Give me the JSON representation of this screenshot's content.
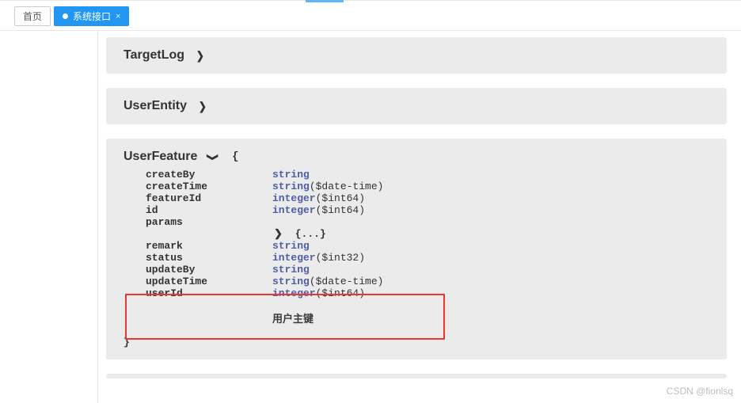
{
  "top_marker": "",
  "tabs": {
    "home": "首页",
    "active": "系统接口",
    "close_glyph": "×"
  },
  "models": {
    "targetlog": {
      "title": "TargetLog"
    },
    "userentity": {
      "title": "UserEntity"
    },
    "userfeature": {
      "title": "UserFeature",
      "open_brace": "{",
      "close_brace": "}",
      "props": [
        {
          "name": "createBy",
          "type": "string",
          "format": ""
        },
        {
          "name": "createTime",
          "type": "string",
          "format": "($date-time)"
        },
        {
          "name": "featureId",
          "type": "integer",
          "format": "($int64)"
        },
        {
          "name": "id",
          "type": "integer",
          "format": "($int64)"
        },
        {
          "name": "params",
          "type": "",
          "format": ""
        }
      ],
      "nested": "{...}",
      "props2": [
        {
          "name": "remark",
          "type": "string",
          "format": ""
        },
        {
          "name": "status",
          "type": "integer",
          "format": "($int32)"
        },
        {
          "name": "updateBy",
          "type": "string",
          "format": ""
        },
        {
          "name": "updateTime",
          "type": "string",
          "format": "($date-time)"
        },
        {
          "name": "userId",
          "type": "integer",
          "format": "($int64)"
        }
      ],
      "description": "用户主键"
    }
  },
  "watermark": "CSDN @fionlsq"
}
